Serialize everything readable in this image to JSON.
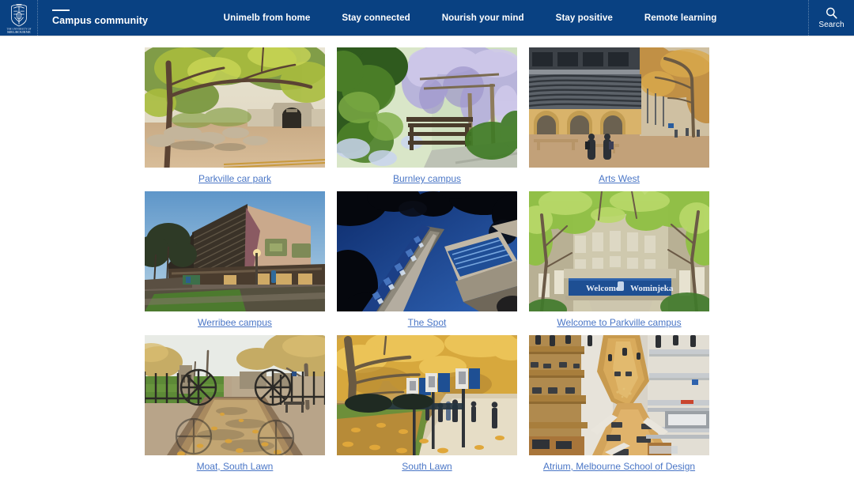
{
  "header": {
    "brand": {
      "logo_name": "university-of-melbourne-crest",
      "line1": "THE UNIVERSITY OF",
      "line2": "MELBOURNE"
    },
    "section_title": "Campus community",
    "nav_items": [
      {
        "label": "Unimelb from home"
      },
      {
        "label": "Stay connected"
      },
      {
        "label": "Nourish your mind"
      },
      {
        "label": "Stay positive"
      },
      {
        "label": "Remote learning"
      }
    ],
    "search": {
      "icon": "search-icon",
      "label": "Search"
    },
    "background_color": "#094182"
  },
  "gallery": {
    "rows": [
      {
        "tiles": [
          {
            "caption": "Parkville car park",
            "image": "parkville-car-park",
            "alt": "Autumn trees over a gravel clearing with a stone archway entrance"
          },
          {
            "caption": "Burnley campus",
            "image": "burnley-campus",
            "alt": "Wisteria covered pergola with a timber bench in a garden"
          },
          {
            "caption": "Arts West",
            "image": "arts-west",
            "alt": "Arts West building facade with arches and metal fins, people walking"
          }
        ]
      },
      {
        "tiles": [
          {
            "caption": "Werribee campus",
            "image": "werribee-campus",
            "alt": "Modern campus building at dusk under a blue sky with lawn in front"
          },
          {
            "caption": "The Spot",
            "image": "the-spot",
            "alt": "Upward view of The Spot building against a deep blue sky framed by dark foliage"
          },
          {
            "caption": "Welcome to Parkville campus",
            "image": "welcome-parkville",
            "alt": "Bridge banner reading Welcome Wominjeka seen through green trees"
          }
        ]
      },
      {
        "tiles": [
          {
            "caption": "Moat, South Lawn",
            "image": "moat-south-lawn",
            "alt": "Water moat with floating autumn leaves and iron wheel gates"
          },
          {
            "caption": "South Lawn",
            "image": "south-lawn",
            "alt": "Golden autumn trees lining a path with banners and people walking"
          },
          {
            "caption": "Atrium, Melbourne School of Design",
            "image": "atrium-msd",
            "alt": "Timber atrium interior of the Melbourne School of Design with hanging studio"
          }
        ]
      }
    ],
    "link_color": "#4a76c6"
  }
}
